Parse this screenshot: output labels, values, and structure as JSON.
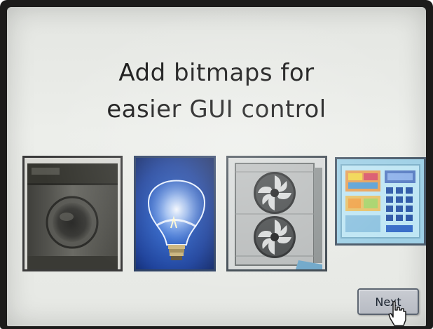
{
  "screen": {
    "title_line1": "Add bitmaps for",
    "title_line2": "easier GUI control"
  },
  "bitmaps": [
    {
      "name": "washing-machine",
      "icon": "washing-machine-icon"
    },
    {
      "name": "light-bulb",
      "icon": "light-bulb-icon"
    },
    {
      "name": "air-conditioner",
      "icon": "air-conditioner-fan-icon"
    },
    {
      "name": "control-panel",
      "icon": "control-panel-keypad-icon"
    }
  ],
  "next_button": {
    "label": "Next"
  },
  "cursor": {
    "icon": "mouse-pointer-icon"
  },
  "colors": {
    "screen_background": "#e8eae6",
    "bezel": "#1c1b1a",
    "title_text": "#141414",
    "button_face": "#c0c3ca",
    "button_border": "#5b6470"
  }
}
